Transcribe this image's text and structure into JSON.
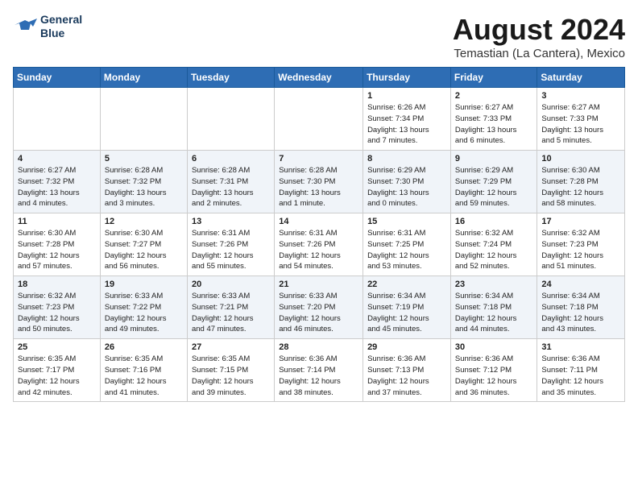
{
  "header": {
    "logo_line1": "General",
    "logo_line2": "Blue",
    "month_year": "August 2024",
    "location": "Temastian (La Cantera), Mexico"
  },
  "weekdays": [
    "Sunday",
    "Monday",
    "Tuesday",
    "Wednesday",
    "Thursday",
    "Friday",
    "Saturday"
  ],
  "weeks": [
    [
      {
        "day": "",
        "info": ""
      },
      {
        "day": "",
        "info": ""
      },
      {
        "day": "",
        "info": ""
      },
      {
        "day": "",
        "info": ""
      },
      {
        "day": "1",
        "info": "Sunrise: 6:26 AM\nSunset: 7:34 PM\nDaylight: 13 hours\nand 7 minutes."
      },
      {
        "day": "2",
        "info": "Sunrise: 6:27 AM\nSunset: 7:33 PM\nDaylight: 13 hours\nand 6 minutes."
      },
      {
        "day": "3",
        "info": "Sunrise: 6:27 AM\nSunset: 7:33 PM\nDaylight: 13 hours\nand 5 minutes."
      }
    ],
    [
      {
        "day": "4",
        "info": "Sunrise: 6:27 AM\nSunset: 7:32 PM\nDaylight: 13 hours\nand 4 minutes."
      },
      {
        "day": "5",
        "info": "Sunrise: 6:28 AM\nSunset: 7:32 PM\nDaylight: 13 hours\nand 3 minutes."
      },
      {
        "day": "6",
        "info": "Sunrise: 6:28 AM\nSunset: 7:31 PM\nDaylight: 13 hours\nand 2 minutes."
      },
      {
        "day": "7",
        "info": "Sunrise: 6:28 AM\nSunset: 7:30 PM\nDaylight: 13 hours\nand 1 minute."
      },
      {
        "day": "8",
        "info": "Sunrise: 6:29 AM\nSunset: 7:30 PM\nDaylight: 13 hours\nand 0 minutes."
      },
      {
        "day": "9",
        "info": "Sunrise: 6:29 AM\nSunset: 7:29 PM\nDaylight: 12 hours\nand 59 minutes."
      },
      {
        "day": "10",
        "info": "Sunrise: 6:30 AM\nSunset: 7:28 PM\nDaylight: 12 hours\nand 58 minutes."
      }
    ],
    [
      {
        "day": "11",
        "info": "Sunrise: 6:30 AM\nSunset: 7:28 PM\nDaylight: 12 hours\nand 57 minutes."
      },
      {
        "day": "12",
        "info": "Sunrise: 6:30 AM\nSunset: 7:27 PM\nDaylight: 12 hours\nand 56 minutes."
      },
      {
        "day": "13",
        "info": "Sunrise: 6:31 AM\nSunset: 7:26 PM\nDaylight: 12 hours\nand 55 minutes."
      },
      {
        "day": "14",
        "info": "Sunrise: 6:31 AM\nSunset: 7:26 PM\nDaylight: 12 hours\nand 54 minutes."
      },
      {
        "day": "15",
        "info": "Sunrise: 6:31 AM\nSunset: 7:25 PM\nDaylight: 12 hours\nand 53 minutes."
      },
      {
        "day": "16",
        "info": "Sunrise: 6:32 AM\nSunset: 7:24 PM\nDaylight: 12 hours\nand 52 minutes."
      },
      {
        "day": "17",
        "info": "Sunrise: 6:32 AM\nSunset: 7:23 PM\nDaylight: 12 hours\nand 51 minutes."
      }
    ],
    [
      {
        "day": "18",
        "info": "Sunrise: 6:32 AM\nSunset: 7:23 PM\nDaylight: 12 hours\nand 50 minutes."
      },
      {
        "day": "19",
        "info": "Sunrise: 6:33 AM\nSunset: 7:22 PM\nDaylight: 12 hours\nand 49 minutes."
      },
      {
        "day": "20",
        "info": "Sunrise: 6:33 AM\nSunset: 7:21 PM\nDaylight: 12 hours\nand 47 minutes."
      },
      {
        "day": "21",
        "info": "Sunrise: 6:33 AM\nSunset: 7:20 PM\nDaylight: 12 hours\nand 46 minutes."
      },
      {
        "day": "22",
        "info": "Sunrise: 6:34 AM\nSunset: 7:19 PM\nDaylight: 12 hours\nand 45 minutes."
      },
      {
        "day": "23",
        "info": "Sunrise: 6:34 AM\nSunset: 7:18 PM\nDaylight: 12 hours\nand 44 minutes."
      },
      {
        "day": "24",
        "info": "Sunrise: 6:34 AM\nSunset: 7:18 PM\nDaylight: 12 hours\nand 43 minutes."
      }
    ],
    [
      {
        "day": "25",
        "info": "Sunrise: 6:35 AM\nSunset: 7:17 PM\nDaylight: 12 hours\nand 42 minutes."
      },
      {
        "day": "26",
        "info": "Sunrise: 6:35 AM\nSunset: 7:16 PM\nDaylight: 12 hours\nand 41 minutes."
      },
      {
        "day": "27",
        "info": "Sunrise: 6:35 AM\nSunset: 7:15 PM\nDaylight: 12 hours\nand 39 minutes."
      },
      {
        "day": "28",
        "info": "Sunrise: 6:36 AM\nSunset: 7:14 PM\nDaylight: 12 hours\nand 38 minutes."
      },
      {
        "day": "29",
        "info": "Sunrise: 6:36 AM\nSunset: 7:13 PM\nDaylight: 12 hours\nand 37 minutes."
      },
      {
        "day": "30",
        "info": "Sunrise: 6:36 AM\nSunset: 7:12 PM\nDaylight: 12 hours\nand 36 minutes."
      },
      {
        "day": "31",
        "info": "Sunrise: 6:36 AM\nSunset: 7:11 PM\nDaylight: 12 hours\nand 35 minutes."
      }
    ]
  ]
}
